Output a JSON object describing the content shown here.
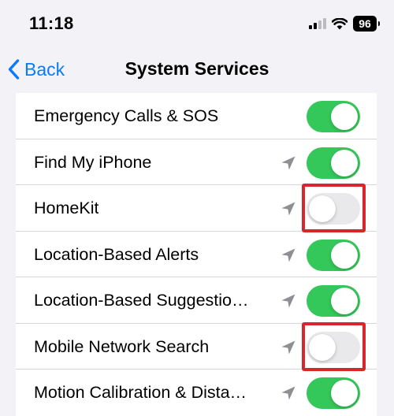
{
  "status_bar": {
    "time": "11:18",
    "battery": "96",
    "signal_icon": "cellular-signal-icon",
    "wifi_icon": "wifi-icon"
  },
  "nav": {
    "back_label": "Back",
    "back_icon": "chevron-left-icon",
    "title": "System Services"
  },
  "colors": {
    "accent": "#0a7aff",
    "toggle_on": "#34c759",
    "toggle_off": "#e9e9eb",
    "highlight": "#d7262c"
  },
  "services": [
    {
      "label": "Emergency Calls & SOS",
      "location_icon": false,
      "enabled": true,
      "highlighted": false
    },
    {
      "label": "Find My iPhone",
      "location_icon": true,
      "enabled": true,
      "highlighted": false
    },
    {
      "label": "HomeKit",
      "location_icon": true,
      "enabled": false,
      "highlighted": true
    },
    {
      "label": "Location-Based Alerts",
      "location_icon": true,
      "enabled": true,
      "highlighted": false
    },
    {
      "label": "Location-Based Suggestio…",
      "location_icon": true,
      "enabled": true,
      "highlighted": false
    },
    {
      "label": "Mobile Network Search",
      "location_icon": true,
      "enabled": false,
      "highlighted": true
    },
    {
      "label": "Motion Calibration & Dista…",
      "location_icon": true,
      "enabled": true,
      "highlighted": false
    }
  ]
}
